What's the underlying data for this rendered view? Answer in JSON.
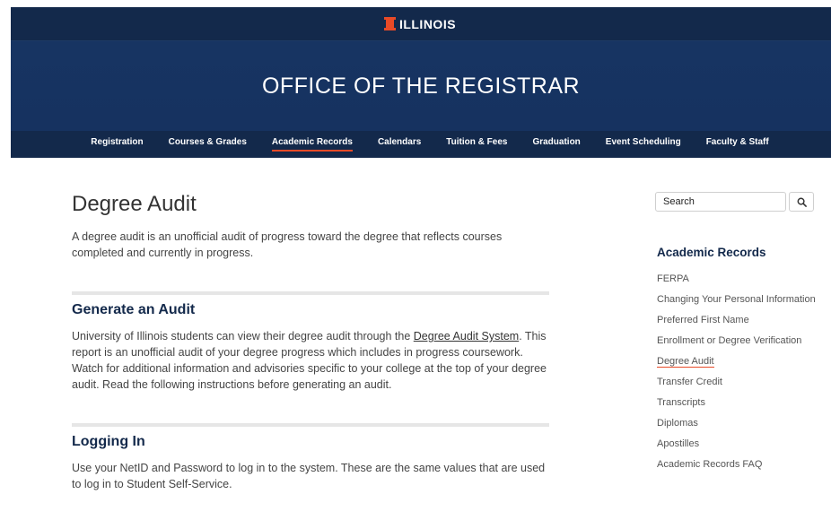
{
  "header": {
    "brand": "ILLINOIS",
    "site_title": "OFFICE OF THE REGISTRAR"
  },
  "nav": {
    "items": [
      "Registration",
      "Courses & Grades",
      "Academic Records",
      "Calendars",
      "Tuition & Fees",
      "Graduation",
      "Event Scheduling",
      "Faculty & Staff"
    ],
    "active": "Academic Records"
  },
  "main": {
    "title": "Degree Audit",
    "intro": "A degree audit is an unofficial audit of progress toward the degree that reflects courses completed and currently in progress.",
    "sections": [
      {
        "heading": "Generate an Audit",
        "text_before": "University of Illinois students can view their degree audit through the ",
        "link": "Degree Audit System",
        "text_after": ". This report is an unofficial audit of your degree progress which includes in progress coursework. Watch for additional information and advisories specific to your college at the top of your degree audit. Read the following instructions before generating an audit."
      },
      {
        "heading": "Logging In",
        "text": "Use your NetID and Password to log in to the system. These are the same values that are used to log in to Student Self-Service."
      }
    ]
  },
  "sidebar": {
    "search_placeholder": "Search",
    "search_icon": "search-icon",
    "heading": "Academic Records",
    "items": [
      "FERPA",
      "Changing Your Personal Information",
      "Preferred First Name",
      "Enrollment or Degree Verification",
      "Degree Audit",
      "Transfer Credit",
      "Transcripts",
      "Diplomas",
      "Apostilles",
      "Academic Records FAQ"
    ],
    "active": "Degree Audit"
  },
  "colors": {
    "navy": "#13294b",
    "orange": "#e84a27"
  }
}
